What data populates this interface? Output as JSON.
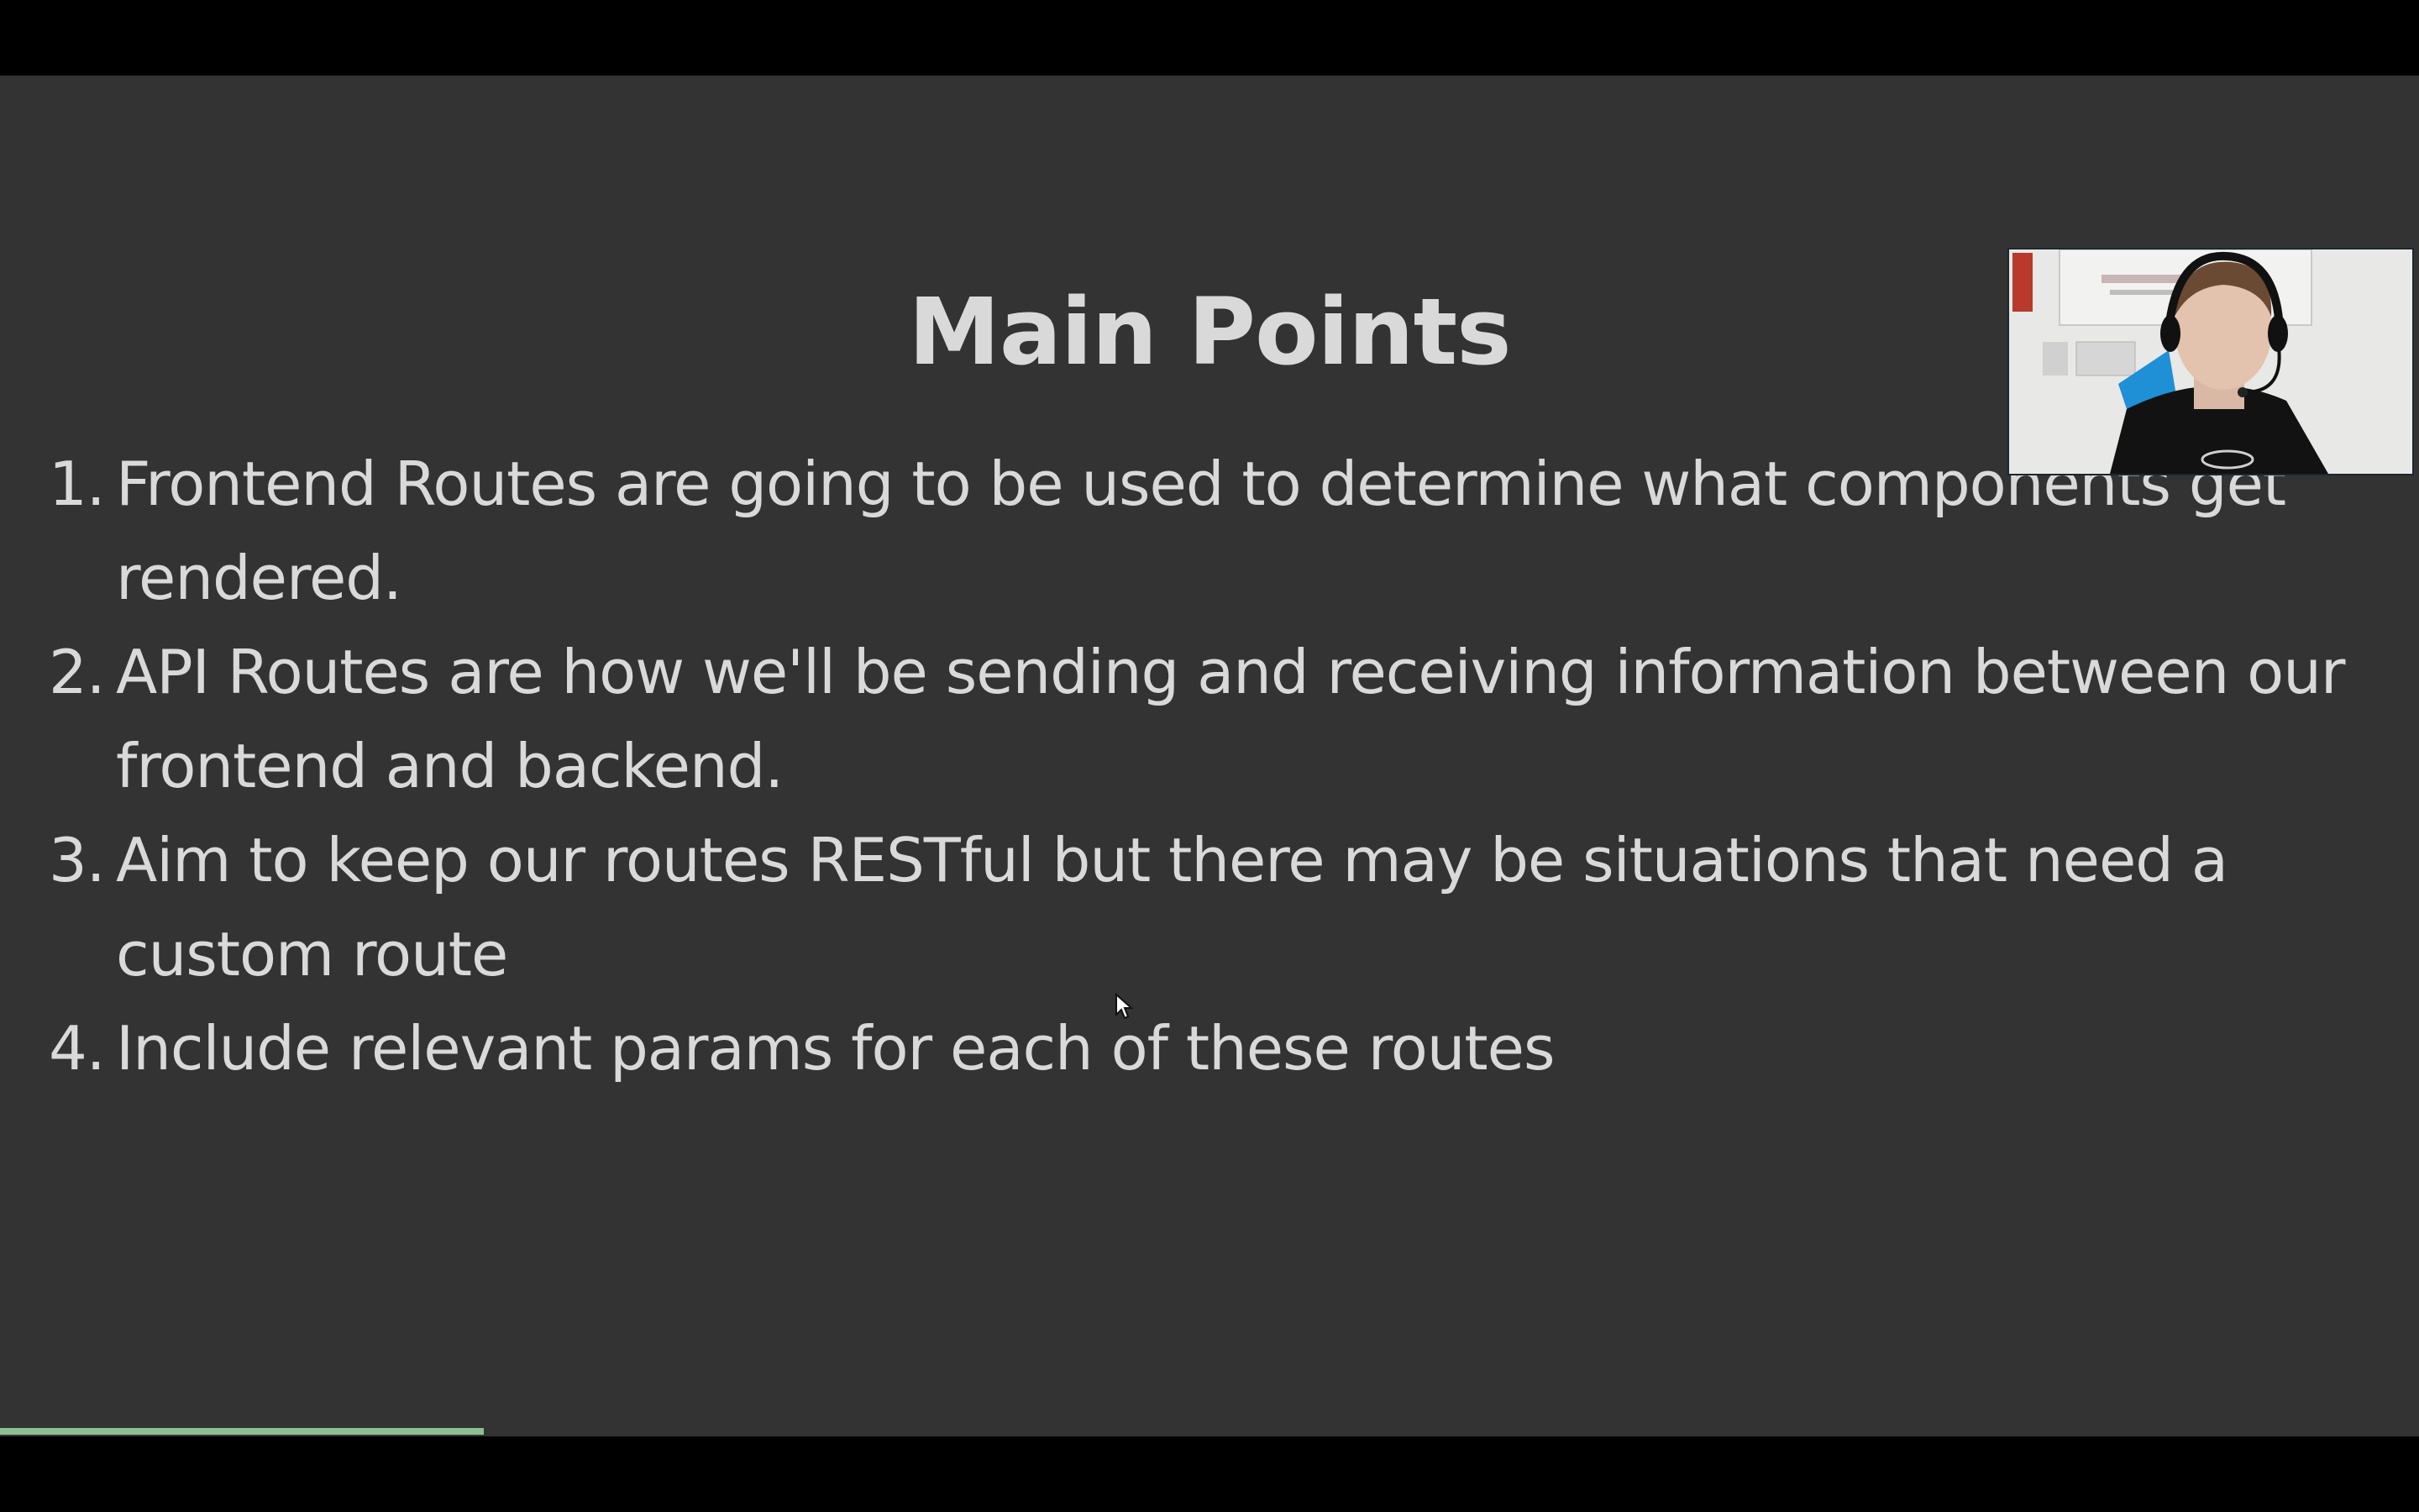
{
  "slide": {
    "title": "Main Points",
    "points": [
      {
        "number": "1.",
        "text": "Frontend Routes are going to be used to determine what components get rendered."
      },
      {
        "number": "2.",
        "text": "API Routes are how we'll be sending and receiving information between our frontend and backend."
      },
      {
        "number": "3.",
        "text": "Aim to keep our routes RESTful but there may be situations that need a custom route"
      },
      {
        "number": "4.",
        "text": "Include relevant params for each of these routes"
      }
    ]
  },
  "playback": {
    "progress_fraction": 0.2
  },
  "colors": {
    "slide_background": "#333333",
    "text": "#d9d9d9",
    "letterbox": "#000000",
    "progress": "#8cc08f"
  },
  "icons": {
    "cursor": "mouse-pointer-icon"
  }
}
